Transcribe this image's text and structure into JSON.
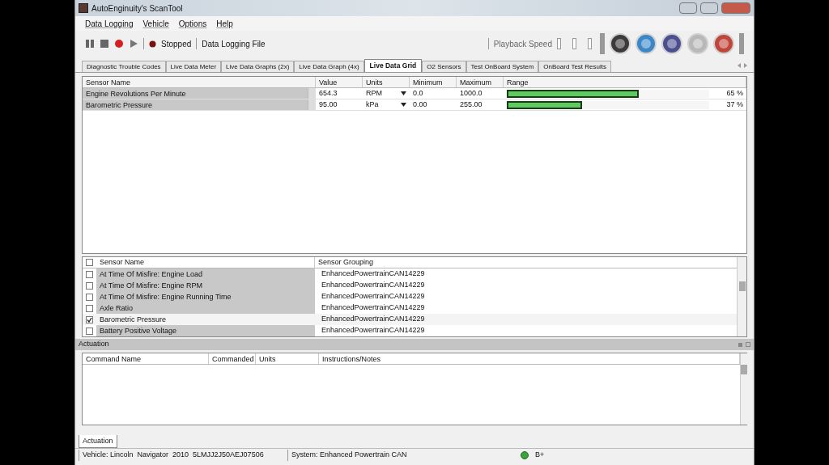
{
  "window": {
    "title": "AutoEnginuity's ScanTool"
  },
  "menu": [
    "Data Logging",
    "Vehicle",
    "Options",
    "Help"
  ],
  "toolbar": {
    "status": "Stopped",
    "log_file": "Data Logging File",
    "playback_label": "Playback Speed"
  },
  "tabs": [
    {
      "label": "Diagnostic Trouble Codes",
      "selected": false
    },
    {
      "label": "Live Data Meter",
      "selected": false
    },
    {
      "label": "Live Data Graphs (2x)",
      "selected": false
    },
    {
      "label": "Live Data Graph (4x)",
      "selected": false
    },
    {
      "label": "Live Data Grid",
      "selected": true
    },
    {
      "label": "O2 Sensors",
      "selected": false
    },
    {
      "label": "Test OnBoard System",
      "selected": false
    },
    {
      "label": "OnBoard Test Results",
      "selected": false
    }
  ],
  "grid": {
    "columns": [
      "Sensor Name",
      "Value",
      "Units",
      "Minimum",
      "Maximum",
      "Range"
    ],
    "rows": [
      {
        "name": "Engine Revolutions Per Minute",
        "value": "654.3",
        "units": "RPM",
        "minimum": "0.0",
        "maximum": "1000.0",
        "level": 0.65,
        "percent": "65 %"
      },
      {
        "name": "Barometric Pressure",
        "value": "95.00",
        "units": "kPa",
        "minimum": "0.00",
        "maximum": "255.00",
        "level": 0.37,
        "percent": "37 %"
      }
    ]
  },
  "sensor_list": {
    "all_checked": false,
    "columns": [
      "Sensor Name",
      "Sensor Grouping"
    ],
    "rows": [
      {
        "name": "At Time Of Misfire: Engine Load",
        "group": "EnhancedPowertrainCAN14229",
        "checked": false
      },
      {
        "name": "At Time Of Misfire: Engine RPM",
        "group": "EnhancedPowertrainCAN14229",
        "checked": false
      },
      {
        "name": "At Time Of Misfire: Engine Running Time",
        "group": "EnhancedPowertrainCAN14229",
        "checked": false
      },
      {
        "name": "Axle Ratio",
        "group": "EnhancedPowertrainCAN14229",
        "checked": false
      },
      {
        "name": "Barometric Pressure",
        "group": "EnhancedPowertrainCAN14229",
        "checked": true
      },
      {
        "name": "Battery Positive Voltage",
        "group": "EnhancedPowertrainCAN14229",
        "checked": false
      }
    ]
  },
  "actuation": {
    "title": "Actuation",
    "columns": [
      "Command Name",
      "Commanded",
      "Units",
      "Instructions/Notes"
    ]
  },
  "bottom_tabs": [
    {
      "label": "Actuation",
      "selected": true
    }
  ],
  "status_bar": {
    "vehicle": "Vehicle: Lincoln  Navigator  2010  5LMJJ2J50AEJ07506",
    "system": "System: Enhanced Powertrain CAN",
    "battery": "B+"
  }
}
